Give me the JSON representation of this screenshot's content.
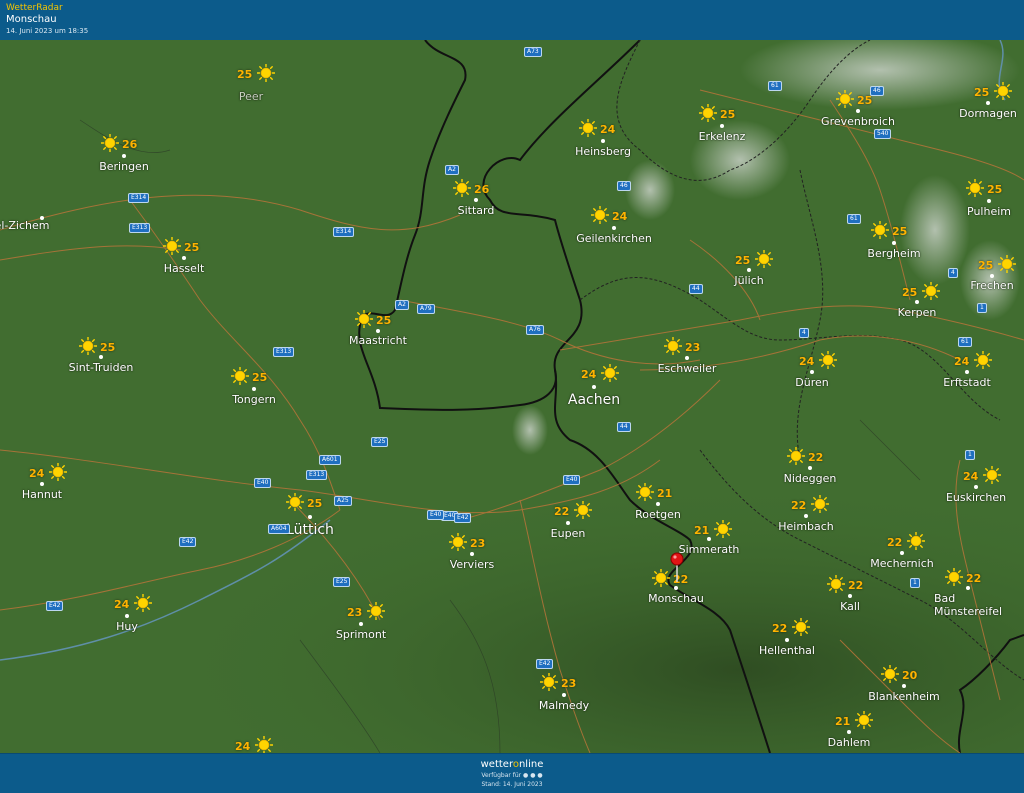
{
  "header": {
    "brand": "WetterRadar",
    "location": "Monschau",
    "timestamp": "14. Juni 2023 um 18:35"
  },
  "footer": {
    "logo_pre": "wetter",
    "logo_o": "o",
    "logo_post": "nline",
    "available": "Verfügbar für ● ● ●",
    "stand": "Stand: 14. Juni 2023"
  },
  "colors": {
    "header_bg": "#0c5b8b",
    "temp": "#ffb300",
    "sun": "#ffd400",
    "border": "#111111",
    "road_badge": "#1f6fc0"
  },
  "cities": [
    {
      "name": "Peer",
      "temp": "25",
      "dim": true
    },
    {
      "name": "Beringen",
      "temp": "26"
    },
    {
      "name": "el-Zichem",
      "temp": ""
    },
    {
      "name": "Hasselt",
      "temp": "25"
    },
    {
      "name": "Sint-Truiden",
      "temp": "25"
    },
    {
      "name": "Tongern",
      "temp": "25"
    },
    {
      "name": "Hannut",
      "temp": "24"
    },
    {
      "name": "Lüttich",
      "temp": "25",
      "big": true
    },
    {
      "name": "Huy",
      "temp": "24"
    },
    {
      "name": "Sprimont",
      "temp": "23"
    },
    {
      "name": "Verviers",
      "temp": "23"
    },
    {
      "name": "Eupen",
      "temp": "22"
    },
    {
      "name": "Malmedy",
      "temp": "23"
    },
    {
      "name": "Sittard",
      "temp": "26"
    },
    {
      "name": "Maastricht",
      "temp": "25"
    },
    {
      "name": "Heinsberg",
      "temp": "24"
    },
    {
      "name": "Geilenkirchen",
      "temp": "24"
    },
    {
      "name": "Erkelenz",
      "temp": "25"
    },
    {
      "name": "Grevenbroich",
      "temp": "25"
    },
    {
      "name": "Dormagen",
      "temp": "25"
    },
    {
      "name": "Pulheim",
      "temp": "25"
    },
    {
      "name": "Bergheim",
      "temp": "25"
    },
    {
      "name": "Frechen",
      "temp": "25"
    },
    {
      "name": "Kerpen",
      "temp": "25"
    },
    {
      "name": "Jülich",
      "temp": "25"
    },
    {
      "name": "Eschweiler",
      "temp": "23"
    },
    {
      "name": "Aachen",
      "temp": "24",
      "big": true
    },
    {
      "name": "Düren",
      "temp": "24"
    },
    {
      "name": "Erftstadt",
      "temp": "24"
    },
    {
      "name": "Nideggen",
      "temp": "22"
    },
    {
      "name": "Euskirchen",
      "temp": "24"
    },
    {
      "name": "Roetgen",
      "temp": "21"
    },
    {
      "name": "Heimbach",
      "temp": "22"
    },
    {
      "name": "Simmerath",
      "temp": "21"
    },
    {
      "name": "Monschau",
      "temp": "22"
    },
    {
      "name": "Mechernich",
      "temp": "22"
    },
    {
      "name": "Kall",
      "temp": "22"
    },
    {
      "name": "Bad Münstereifel",
      "temp": "22"
    },
    {
      "name": "Hellenthal",
      "temp": "22"
    },
    {
      "name": "Blankenheim",
      "temp": "20"
    },
    {
      "name": "Dahlem",
      "temp": "21"
    },
    {
      "name": "",
      "temp": "24"
    }
  ],
  "roads": [
    "A73",
    "A2",
    "E314",
    "E313",
    "E314",
    "A2",
    "A79",
    "A76",
    "E313",
    "E25",
    "A601",
    "E313",
    "E40",
    "E40",
    "A25",
    "A604",
    "E42",
    "E40",
    "E42",
    "E40",
    "E25",
    "E42",
    "E42",
    "46",
    "61",
    "46",
    "540",
    "61",
    "44",
    "4",
    "4",
    "1",
    "61",
    "44",
    "1",
    "1"
  ]
}
